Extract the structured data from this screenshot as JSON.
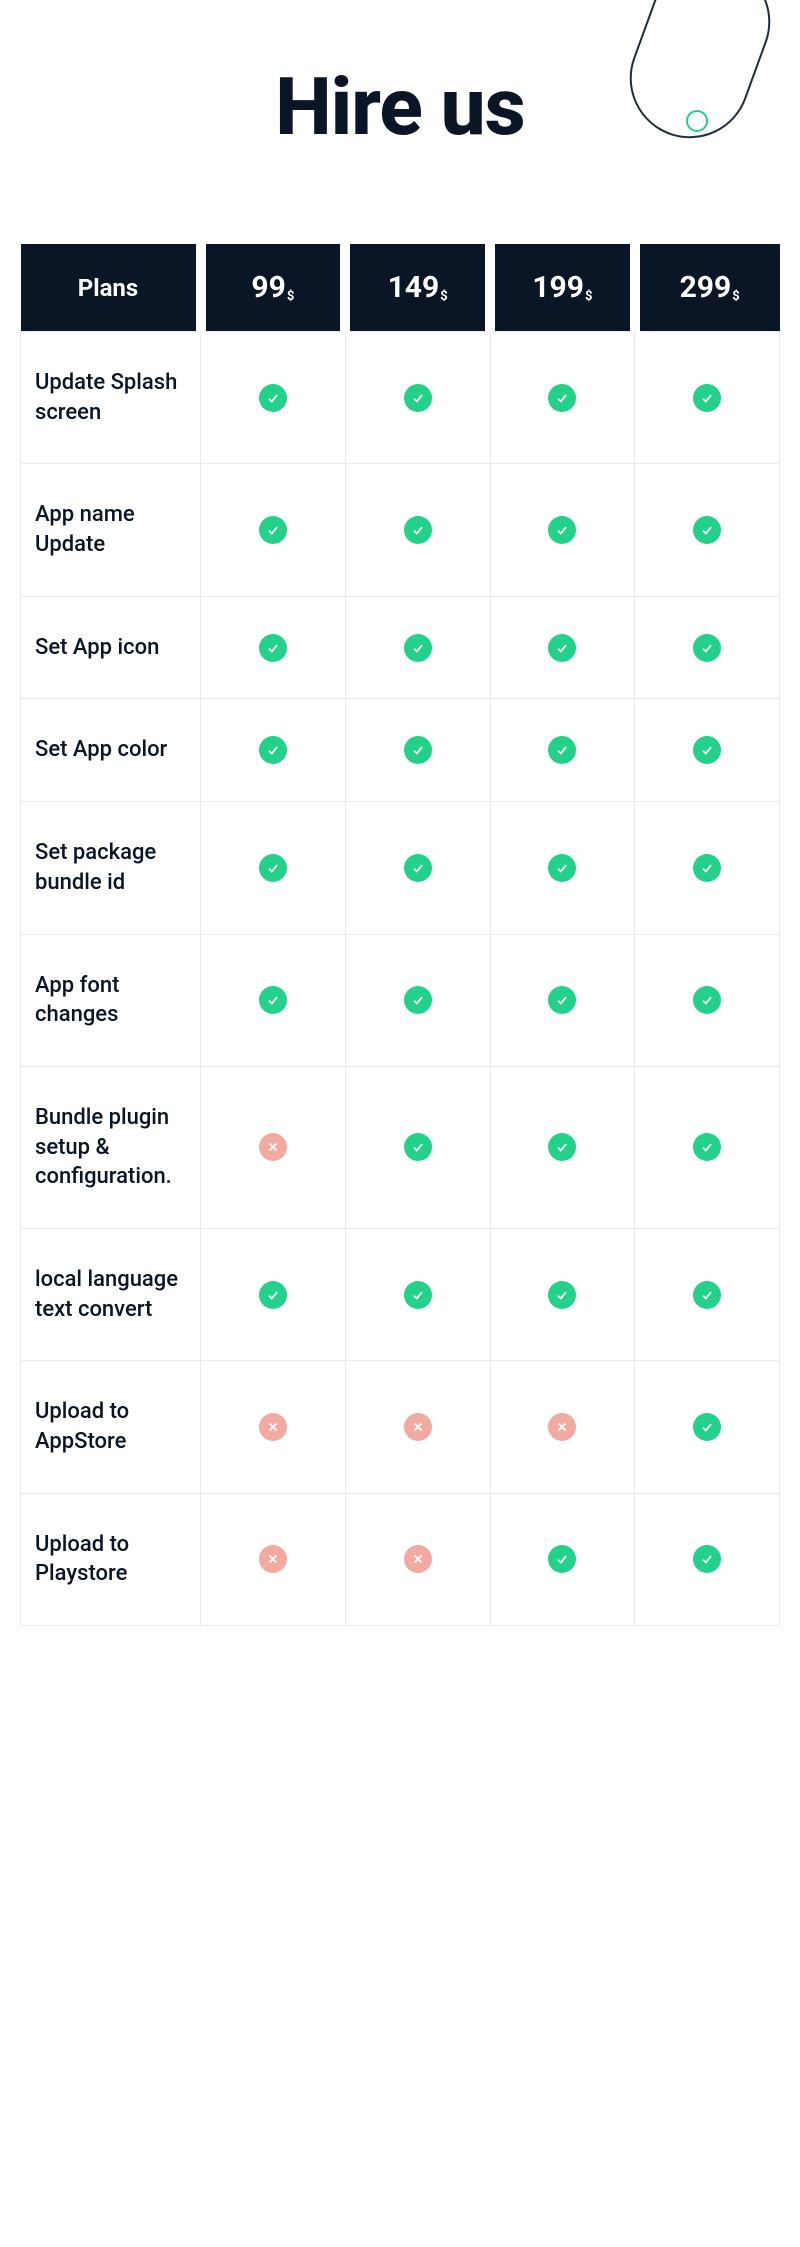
{
  "title": "Hire us",
  "currency": "$",
  "plans_header": "Plans",
  "plans": [
    "99",
    "149",
    "199",
    "299"
  ],
  "features": [
    {
      "label": "Update Splash screen",
      "cells": [
        true,
        true,
        true,
        true
      ]
    },
    {
      "label": "App name Update",
      "cells": [
        true,
        true,
        true,
        true
      ]
    },
    {
      "label": "Set App icon",
      "cells": [
        true,
        true,
        true,
        true
      ]
    },
    {
      "label": "Set App color",
      "cells": [
        true,
        true,
        true,
        true
      ]
    },
    {
      "label": "Set package bundle id",
      "cells": [
        true,
        true,
        true,
        true
      ]
    },
    {
      "label": "App font changes",
      "cells": [
        true,
        true,
        true,
        true
      ]
    },
    {
      "label": "Bundle plugin setup & configuration.",
      "cells": [
        false,
        true,
        true,
        true
      ]
    },
    {
      "label": "local language text convert",
      "cells": [
        true,
        true,
        true,
        true
      ]
    },
    {
      "label": "Upload to AppStore",
      "cells": [
        false,
        false,
        false,
        true
      ]
    },
    {
      "label": "Upload to Playstore",
      "cells": [
        false,
        false,
        true,
        true
      ]
    }
  ]
}
